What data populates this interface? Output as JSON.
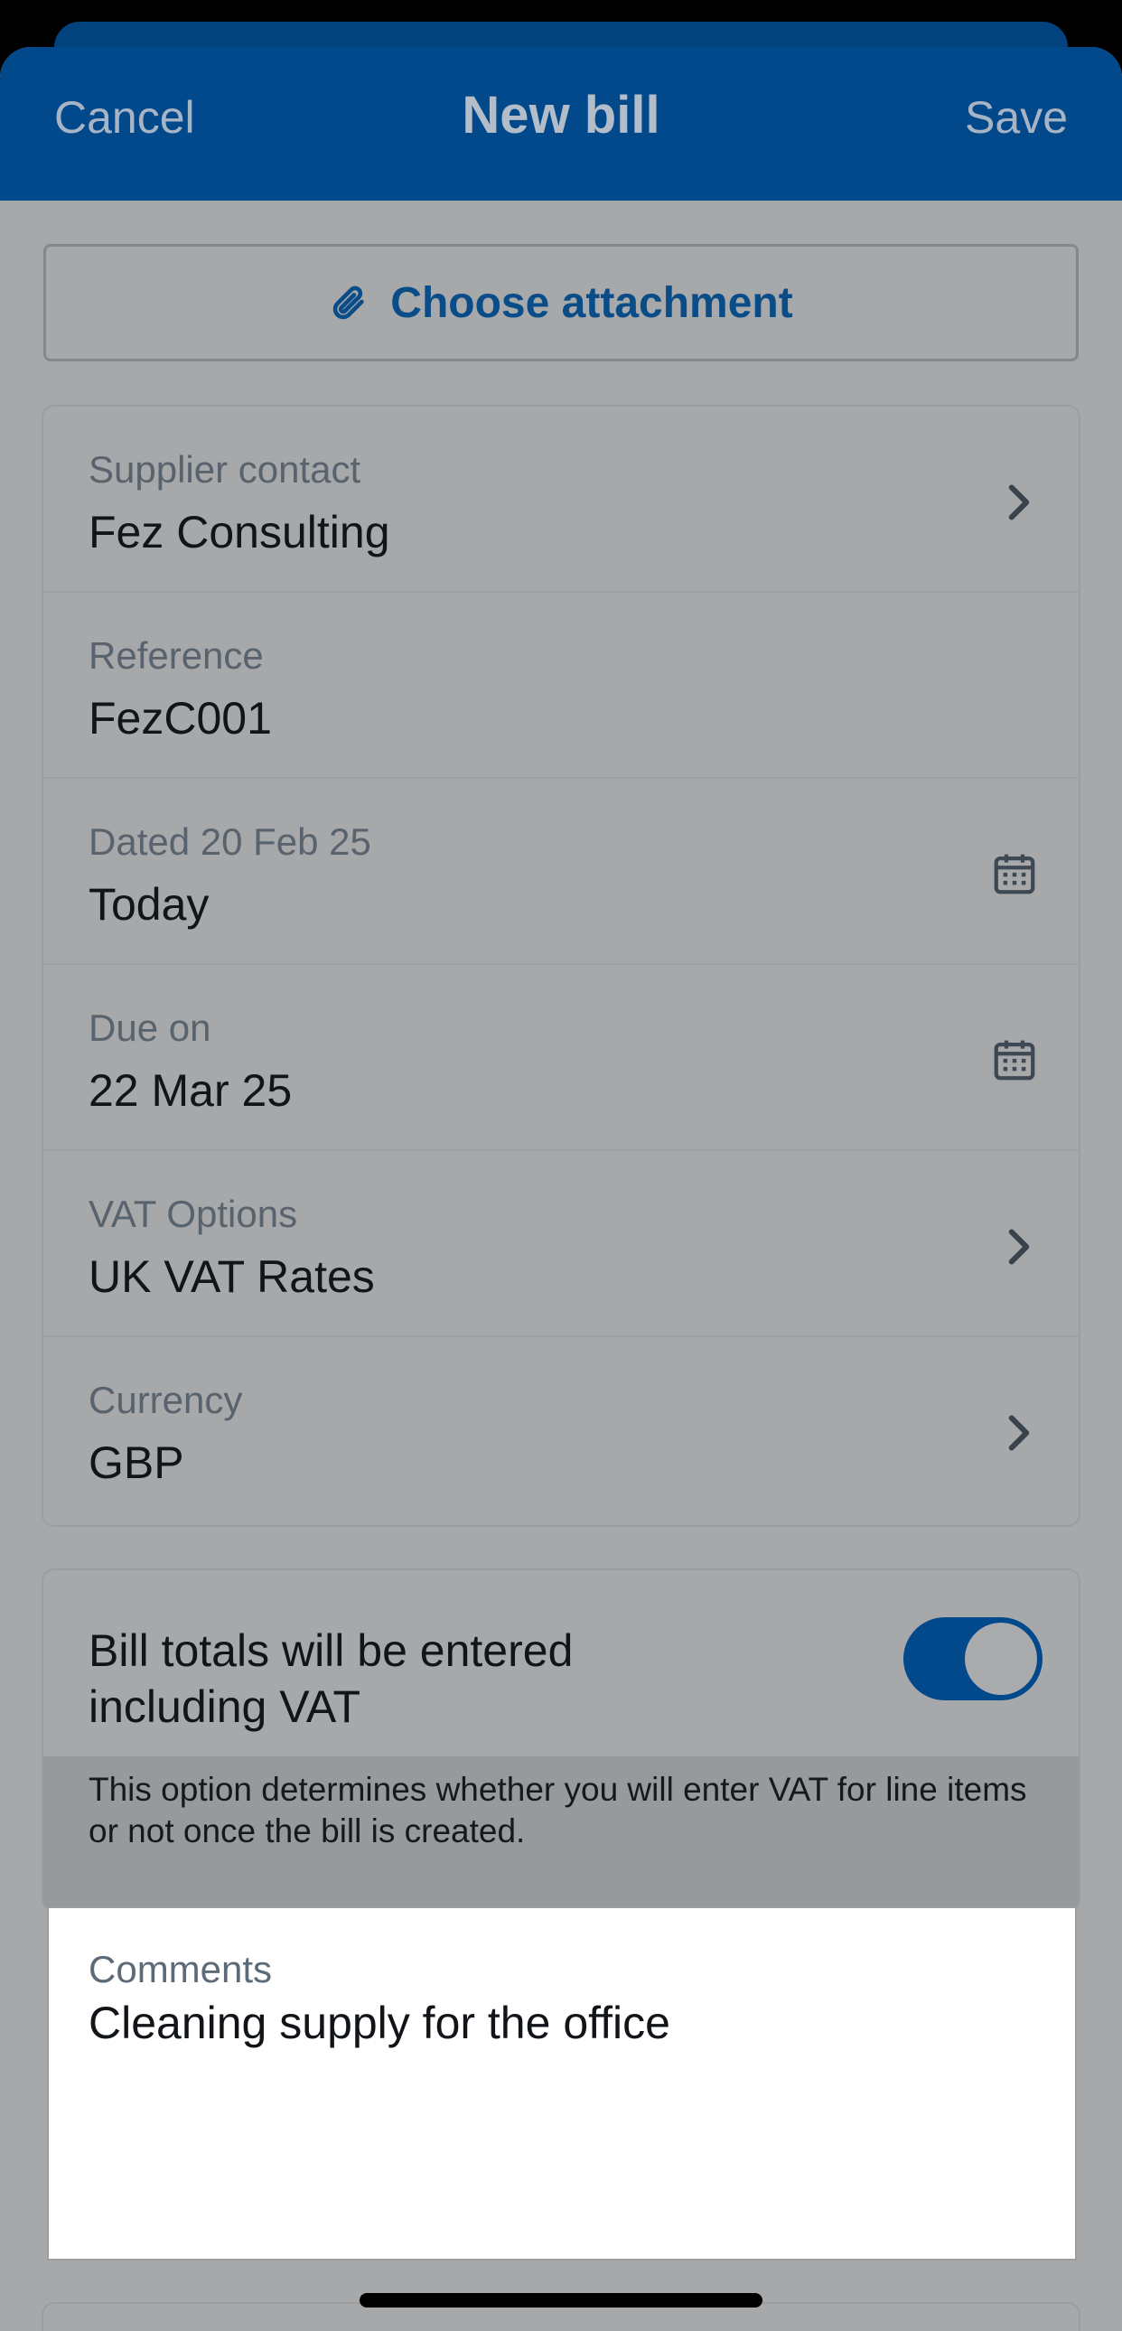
{
  "header": {
    "cancel_label": "Cancel",
    "title": "New bill",
    "save_label": "Save"
  },
  "attachment": {
    "label": "Choose attachment",
    "icon": "paperclip-icon"
  },
  "fields": [
    {
      "label": "Supplier contact",
      "value": "Fez Consulting",
      "icon": "chevron-right-icon"
    },
    {
      "label": "Reference",
      "value": "FezC001"
    },
    {
      "label": "Dated 20 Feb 25",
      "value": "Today",
      "icon": "calendar-icon"
    },
    {
      "label": "Due on",
      "value": "22 Mar 25",
      "icon": "calendar-icon"
    },
    {
      "label": "VAT Options",
      "value": "UK VAT Rates",
      "icon": "chevron-right-icon"
    },
    {
      "label": "Currency",
      "value": "GBP",
      "icon": "chevron-right-icon"
    }
  ],
  "vat_toggle": {
    "label": "Bill totals will be entered including VAT",
    "on": true,
    "help": "This option determines whether you will enter VAT for line items or not once the bill is created."
  },
  "comments": {
    "label": "Comments",
    "value": "Cleaning supply for the office"
  },
  "colors": {
    "header_bg": "#02498c",
    "accent": "#0a4c88",
    "overlay_bg": "#a6a8aa"
  }
}
